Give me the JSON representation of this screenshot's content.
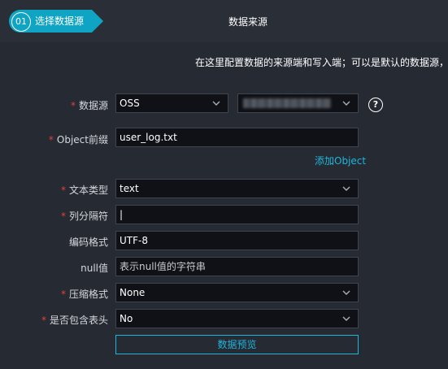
{
  "step": {
    "number": "01",
    "label": "选择数据源"
  },
  "section_title": "数据来源",
  "description": "在这里配置数据的来源端和写入端；可以是默认的数据源，",
  "form": {
    "datasource": {
      "label": "数据源",
      "type_value": "OSS"
    },
    "object_prefix": {
      "label": "Object前缀",
      "value": "user_log.txt"
    },
    "add_object": "添加Object",
    "text_type": {
      "label": "文本类型",
      "value": "text"
    },
    "delimiter": {
      "label": "列分隔符",
      "value": "|"
    },
    "encoding": {
      "label": "编码格式",
      "value": "UTF-8"
    },
    "null_value": {
      "label": "null值",
      "value": "表示null值的字符串"
    },
    "compression": {
      "label": "压缩格式",
      "value": "None"
    },
    "header": {
      "label": "是否包含表头",
      "value": "No"
    },
    "preview_button": "数据预览"
  },
  "help_symbol": "?",
  "colors": {
    "accent": "#0fa3c4",
    "link": "#1fb6dd",
    "required": "#e0413b",
    "background": "#262a32"
  },
  "icons": [
    "chevron-down-icon",
    "help-icon"
  ]
}
